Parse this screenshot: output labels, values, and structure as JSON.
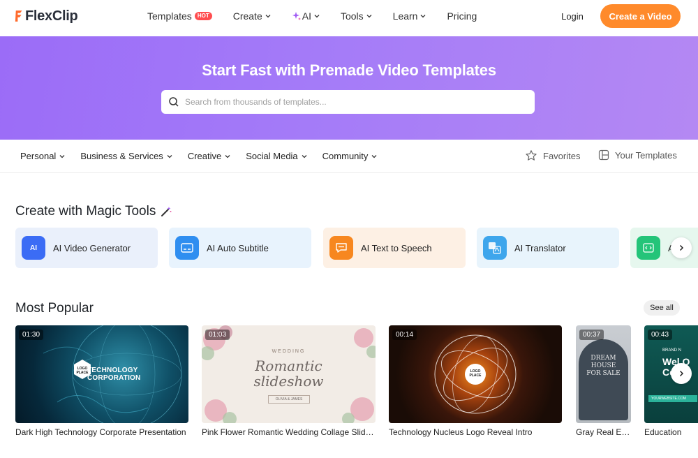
{
  "header": {
    "logo_text": "FlexClip",
    "nav": [
      {
        "label": "Templates",
        "badge": "HOT"
      },
      {
        "label": "Create"
      },
      {
        "label": "AI"
      },
      {
        "label": "Tools"
      },
      {
        "label": "Learn"
      },
      {
        "label": "Pricing"
      }
    ],
    "login_label": "Login",
    "cta_label": "Create a Video"
  },
  "hero": {
    "title": "Start Fast with Premade Video Templates",
    "search_placeholder": "Search from thousands of templates..."
  },
  "categories": {
    "items": [
      "Personal",
      "Business & Services",
      "Creative",
      "Social Media",
      "Community"
    ],
    "favorites_label": "Favorites",
    "your_templates_label": "Your Templates"
  },
  "magic_tools": {
    "title": "Create with Magic Tools",
    "items": [
      {
        "label": "AI Video Generator",
        "icon": "ai-video-icon",
        "bg": "#eaf0fb",
        "icon_color": "#3b6cf5"
      },
      {
        "label": "AI Auto Subtitle",
        "icon": "subtitle-icon",
        "bg": "#e8f3fd",
        "icon_color": "#2f8ef0"
      },
      {
        "label": "AI Text to Speech",
        "icon": "speech-icon",
        "bg": "#fdf0e4",
        "icon_color": "#f7871f"
      },
      {
        "label": "AI Translator",
        "icon": "translate-icon",
        "bg": "#e8f4fc",
        "icon_color": "#3ea6ec"
      },
      {
        "label": "AI",
        "icon": "code-icon",
        "bg": "#e6f7ee",
        "icon_color": "#24c479"
      }
    ]
  },
  "popular": {
    "title": "Most Popular",
    "see_all_label": "See all",
    "items": [
      {
        "duration": "01:30",
        "title": "Dark High Technology Corporate Presentation",
        "thumb_text": "TECHNOLOGY CORPORATION",
        "logo_text": "LOGO PLACE"
      },
      {
        "duration": "01:03",
        "title": "Pink Flower Romantic Wedding Collage Slideshow",
        "thumb_top": "WEDDING",
        "thumb_script1": "Romantic",
        "thumb_script2": "slideshow",
        "thumb_names": "OLIVIA & JAMES"
      },
      {
        "duration": "00:14",
        "title": "Technology Nucleus Logo Reveal Intro",
        "logo_text": "LOGO PLACE"
      },
      {
        "duration": "00:37",
        "title": "Gray Real Estate",
        "thumb_line1": "DREAM",
        "thumb_line2": "HOUSE",
        "thumb_line3": "FOR SALE"
      },
      {
        "duration": "00:43",
        "title": "Education",
        "thumb_text": "Wel O Co",
        "thumb_sub": "YOURWEBSITE.COM",
        "thumb_brand": "BRAND N"
      }
    ]
  },
  "colors": {
    "accent": "#ff8a2b",
    "hero_start": "#9b6cf7",
    "hero_end": "#b488f3"
  }
}
